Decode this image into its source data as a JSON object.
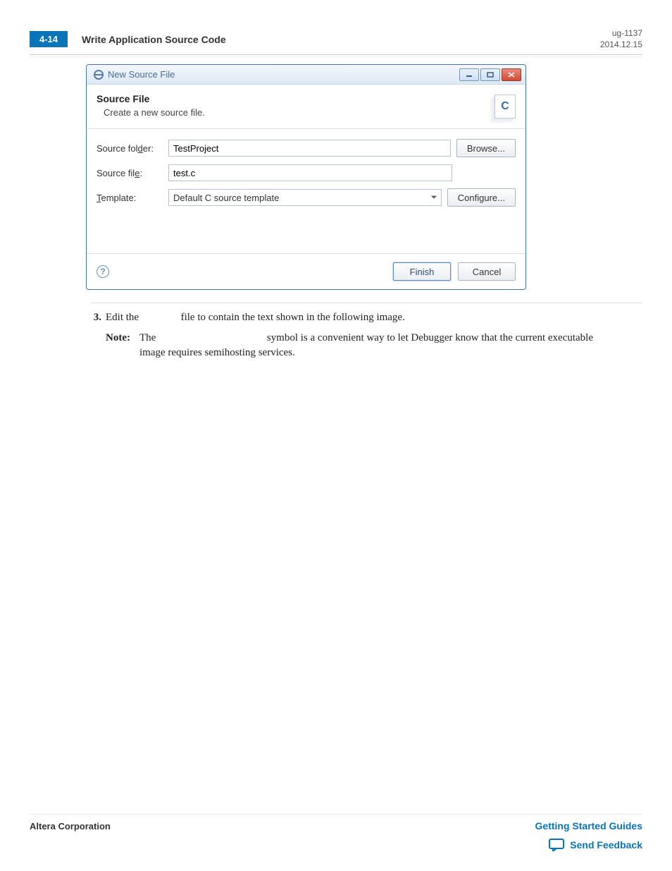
{
  "header": {
    "page_num": "4-14",
    "section": "Write Application Source Code",
    "doc_id": "ug-1137",
    "date": "2014.12.15"
  },
  "dialog": {
    "window_title": "New Source File",
    "title": "Source File",
    "subtitle": "Create a new source file.",
    "labels": {
      "folder_pre": "Source fol",
      "folder_ul": "d",
      "folder_post": "er:",
      "file_pre": "Source fil",
      "file_ul": "e",
      "file_post": ":",
      "tpl_ul": "T",
      "tpl_post": "emplate:"
    },
    "fields": {
      "source_folder": "TestProject",
      "source_file": "test.c",
      "template": "Default C source template"
    },
    "buttons": {
      "browse_ul": "B",
      "browse_post": "rowse...",
      "configure_pre": "Confi",
      "configure_ul": "g",
      "configure_post": "ure...",
      "finish_ul": "F",
      "finish_post": "inish",
      "cancel": "Cancel"
    },
    "c_badge": "C"
  },
  "body": {
    "step_num": "3.",
    "step_text_pre": "Edit the ",
    "step_text_post": " file to contain the text shown in the following image.",
    "note_label": "Note:",
    "note_pre": "The ",
    "note_post": " symbol is a convenient way to let Debugger know that the current executable image requires semihosting services."
  },
  "footer": {
    "company": "Altera Corporation",
    "guide_link": "Getting Started Guides",
    "feedback": "Send Feedback"
  }
}
